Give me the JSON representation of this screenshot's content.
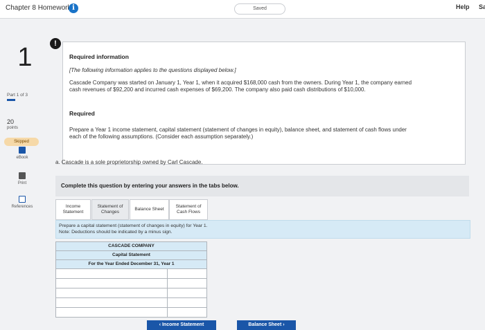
{
  "header": {
    "title": "Chapter 8 Homework",
    "info_icon": "i",
    "saved": "Saved",
    "help": "Help",
    "help2": "Sa"
  },
  "sidebar": {
    "question_number": "1",
    "part": "Part 1 of 3",
    "points_value": "20",
    "points_label": "points",
    "status": "Skipped",
    "ebook": "eBook",
    "print": "Print",
    "references": "References"
  },
  "required_info": {
    "alert": "!",
    "title": "Required information",
    "note": "[The following information applies to the questions displayed below.]",
    "body": "Cascade Company was started on January 1, Year 1, when it acquired $168,000 cash from the owners. During Year 1, the company earned cash revenues of $92,200 and incurred cash expenses of $69,200. The company also paid cash distributions of $10,000.",
    "required_label": "Required",
    "instructions": "Prepare a Year 1 income statement, capital statement (statement of changes in equity), balance sheet, and statement of cash flows under each of the following assumptions. (Consider each assumption separately.)"
  },
  "question": {
    "scenario": "a. Cascade is a sole proprietorship owned by Carl Cascade.",
    "complete_prompt": "Complete this question by entering your answers in the tabs below."
  },
  "tabs": [
    {
      "label_line1": "Income",
      "label_line2": "Statement"
    },
    {
      "label_line1": "Statement of",
      "label_line2": "Changes"
    },
    {
      "label_line1": "Balance Sheet",
      "label_line2": ""
    },
    {
      "label_line1": "Statement of",
      "label_line2": "Cash Flows"
    }
  ],
  "instruction": {
    "line1": "Prepare a capital statement (statement of changes in equity) for Year 1.",
    "line2": "Note: Deductions should be indicated by a minus sign."
  },
  "table": {
    "company": "CASCADE COMPANY",
    "statement": "Capital Statement",
    "period": "For the Year Ended December 31, Year 1",
    "rows": 5
  },
  "nav": {
    "prev": "‹  Income Statement",
    "next": "Balance Sheet  ›"
  },
  "colors": {
    "accent": "#1a56a8",
    "prompt_bg": "#d6eaf6",
    "skipped_bg": "#f6d9a8"
  }
}
